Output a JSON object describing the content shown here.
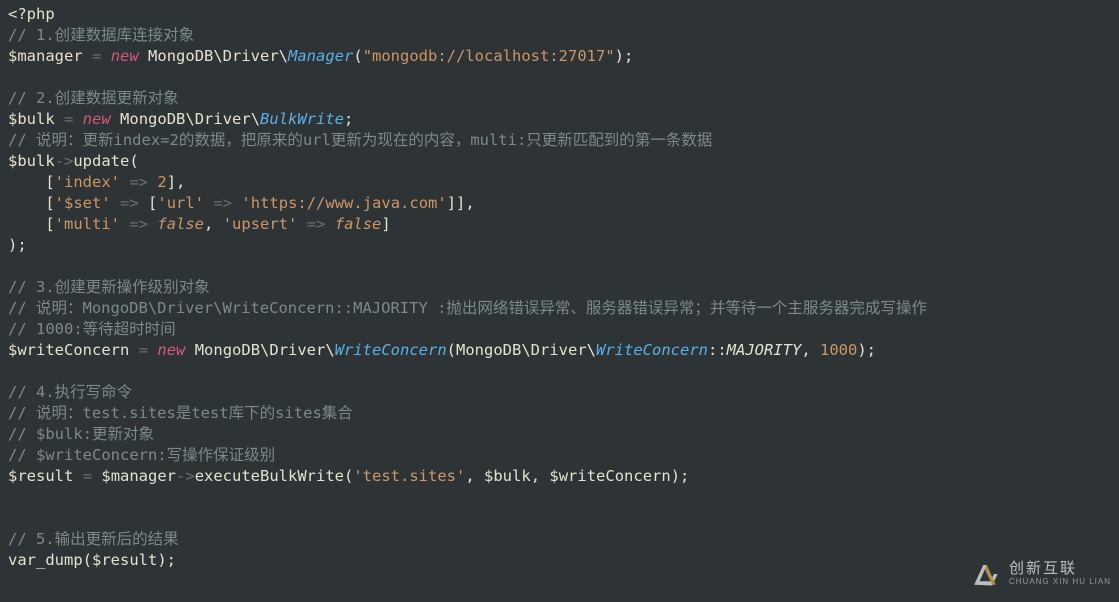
{
  "code": {
    "open_tag": "<?php",
    "c1": "// 1.创建数据库连接对象",
    "l2_var": "$manager",
    "l2_new": "new",
    "l2_ns": "MongoDB\\Driver\\",
    "l2_cls": "Manager",
    "l2_str": "\"mongodb://localhost:27017\"",
    "c2": "// 2.创建数据更新对象",
    "l4_var": "$bulk",
    "l4_new": "new",
    "l4_ns": "MongoDB\\Driver\\",
    "l4_cls": "BulkWrite",
    "c3": "// 说明：更新index=2的数据，把原来的url更新为现在的内容，multi:只更新匹配到的第一条数据",
    "l6_var": "$bulk",
    "l6_fn": "update",
    "l7_k": "'index'",
    "l7_v": "2",
    "l8_k": "'$set'",
    "l8_k2": "'url'",
    "l8_v": "'https://www.java.com'",
    "l9_k1": "'multi'",
    "l9_v1": "false",
    "l9_k2": "'upsert'",
    "l9_v2": "false",
    "c4": "// 3.创建更新操作级别对象",
    "c5": "// 说明：MongoDB\\Driver\\WriteConcern::MAJORITY :抛出网络错误异常、服务器错误异常；并等待一个主服务器完成写操作",
    "c6": "// 1000:等待超时时间",
    "l14_var": "$writeConcern",
    "l14_new": "new",
    "l14_ns": "MongoDB\\Driver\\",
    "l14_cls": "WriteConcern",
    "l14_ns2": "MongoDB\\Driver\\",
    "l14_cls2": "WriteConcern",
    "l14_const": "MAJORITY",
    "l14_num": "1000",
    "c7": "// 4.执行写命令",
    "c8": "// 说明：test.sites是test库下的sites集合",
    "c9": "// $bulk:更新对象",
    "c10": "// $writeConcern:写操作保证级别",
    "l19_var": "$result",
    "l19_obj": "$manager",
    "l19_fn": "executeBulkWrite",
    "l19_s1": "'test.sites'",
    "l19_v2": "$bulk",
    "l19_v3": "$writeConcern",
    "c11": "// 5.输出更新后的结果",
    "l21_fn": "var_dump",
    "l21_arg": "$result"
  },
  "watermark": {
    "cn_text": "创新互联",
    "en_text": "CHUANG XIN HU LIAN"
  }
}
